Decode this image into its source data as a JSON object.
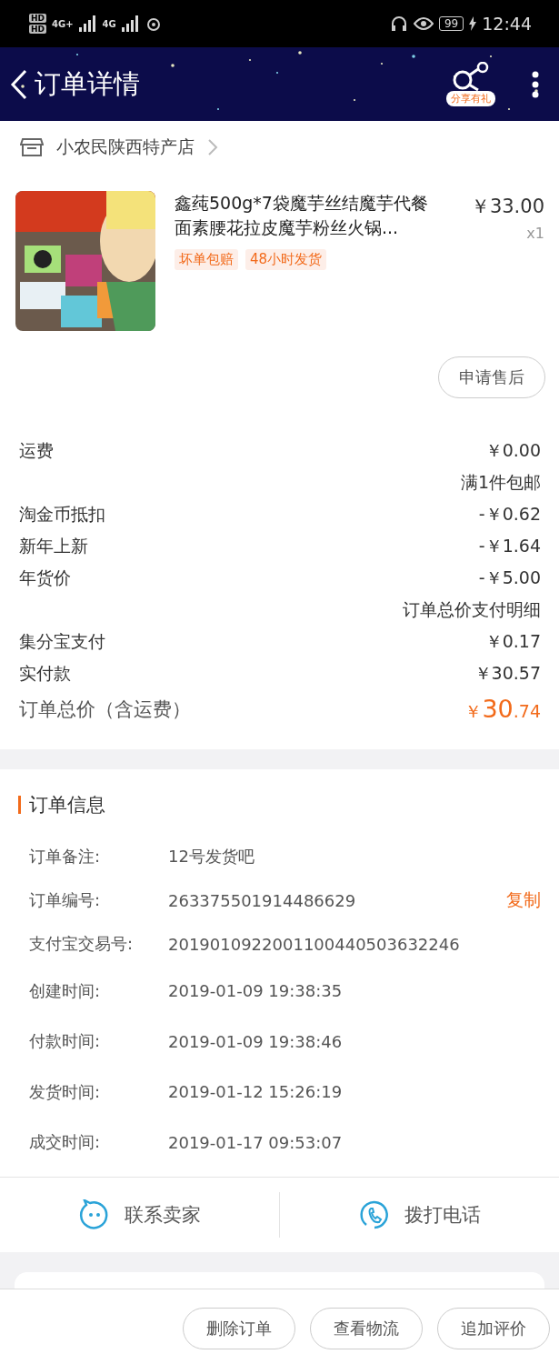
{
  "status_bar": {
    "sim_labels": [
      "HD",
      "HD"
    ],
    "networks": [
      "4G+",
      "4G"
    ],
    "battery": "99",
    "time": "12:44"
  },
  "header": {
    "title": "订单详情",
    "share_badge": "分享有礼"
  },
  "store": {
    "name": "小农民陕西特产店"
  },
  "product": {
    "kind": "picture",
    "title": "鑫莼500g*7袋魔芋丝结魔芋代餐面素腰花拉皮魔芋粉丝火锅...",
    "price": "￥33.00",
    "quantity": "x1",
    "tags": [
      "坏单包赔",
      "48小时发货"
    ],
    "after_sale_button": "申请售后"
  },
  "fees": [
    {
      "label": "运费",
      "value": "￥0.00"
    },
    {
      "value": "满1件包邮"
    },
    {
      "label": "淘金币抵扣",
      "value": "-￥0.62"
    },
    {
      "label": "新年上新",
      "value": "-￥1.64"
    },
    {
      "label": "年货价",
      "value": "-￥5.00"
    },
    {
      "value": "订单总价支付明细"
    },
    {
      "label": "集分宝支付",
      "value": "￥0.17"
    },
    {
      "label": "实付款",
      "value": "￥30.57"
    }
  ],
  "total": {
    "label": "订单总价（含运费）",
    "currency": "￥",
    "integer": "30",
    "decimal": ".74"
  },
  "order_info": {
    "title": "订单信息",
    "rows": [
      {
        "label": "订单备注:",
        "value": "12号发货吧"
      },
      {
        "label": "订单编号:",
        "value": "263375501914486629",
        "action": "复制"
      },
      {
        "label": "支付宝交易号:",
        "value": "2019010922001100440503632246"
      },
      {
        "label": "创建时间:",
        "value": "2019-01-09 19:38:35"
      },
      {
        "label": "付款时间:",
        "value": "2019-01-09 19:38:46"
      },
      {
        "label": "发货时间:",
        "value": "2019-01-12 15:26:19"
      },
      {
        "label": "成交时间:",
        "value": "2019-01-17 09:53:07"
      }
    ]
  },
  "contact": [
    {
      "kind": "chat",
      "label": "联系卖家"
    },
    {
      "kind": "phone",
      "label": "拨打电话"
    }
  ],
  "actions": [
    "删除订单",
    "查看物流",
    "追加评价"
  ]
}
